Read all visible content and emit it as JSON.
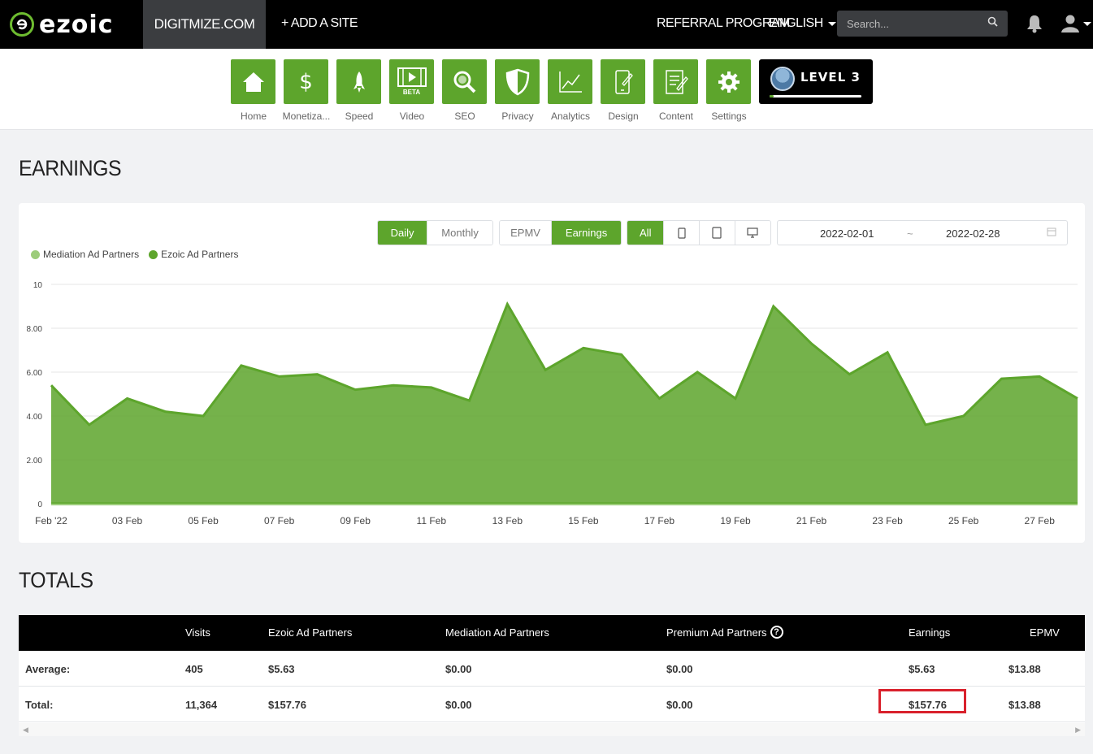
{
  "topbar": {
    "logo_text": "ezoic",
    "site_name": "DIGITMIZE.COM",
    "add_site": "+ ADD A SITE",
    "referral": "REFERRAL PROGRAM",
    "language": "ENGLISH",
    "search_placeholder": "Search..."
  },
  "nav": {
    "items": [
      {
        "label": "Home",
        "icon": "home-icon"
      },
      {
        "label": "Monetiza...",
        "icon": "dollar-icon"
      },
      {
        "label": "Speed",
        "icon": "rocket-icon"
      },
      {
        "label": "Video",
        "icon": "video-icon",
        "badge": "BETA"
      },
      {
        "label": "SEO",
        "icon": "magnifier-icon"
      },
      {
        "label": "Privacy",
        "icon": "shield-icon"
      },
      {
        "label": "Analytics",
        "icon": "line-chart-icon"
      },
      {
        "label": "Design",
        "icon": "mobile-design-icon"
      },
      {
        "label": "Content",
        "icon": "document-edit-icon"
      },
      {
        "label": "Settings",
        "icon": "gear-icon"
      }
    ],
    "level_label": "LEVEL 3",
    "level_progress": 0.04
  },
  "earnings": {
    "title": "EARNINGS",
    "period_buttons": [
      "Daily",
      "Monthly"
    ],
    "metric_buttons": [
      "EPMV",
      "Earnings"
    ],
    "device_all": "All",
    "date_from": "2022-02-01",
    "date_sep": "~",
    "date_to": "2022-02-28"
  },
  "chart_data": {
    "type": "area",
    "x": [
      "Feb '22",
      "02 Feb",
      "03 Feb",
      "04 Feb",
      "05 Feb",
      "06 Feb",
      "07 Feb",
      "08 Feb",
      "09 Feb",
      "10 Feb",
      "11 Feb",
      "12 Feb",
      "13 Feb",
      "14 Feb",
      "15 Feb",
      "16 Feb",
      "17 Feb",
      "18 Feb",
      "19 Feb",
      "20 Feb",
      "21 Feb",
      "22 Feb",
      "23 Feb",
      "24 Feb",
      "25 Feb",
      "26 Feb",
      "27 Feb",
      "28 Feb"
    ],
    "tick_labels": [
      "Feb '22",
      "03 Feb",
      "05 Feb",
      "07 Feb",
      "09 Feb",
      "11 Feb",
      "13 Feb",
      "15 Feb",
      "17 Feb",
      "19 Feb",
      "21 Feb",
      "23 Feb",
      "25 Feb",
      "27 Feb"
    ],
    "y_ticks": [
      "0",
      "2.00",
      "4.00",
      "6.00",
      "8.00",
      "10"
    ],
    "ylim": [
      0,
      10
    ],
    "series": [
      {
        "name": "Mediation Ad Partners",
        "color": "#9ccc7a",
        "values": [
          0,
          0,
          0,
          0,
          0,
          0,
          0,
          0,
          0,
          0,
          0,
          0,
          0,
          0,
          0,
          0,
          0,
          0,
          0,
          0,
          0,
          0,
          0,
          0,
          0,
          0,
          0,
          0
        ]
      },
      {
        "name": "Ezoic Ad Partners",
        "color": "#5da52c",
        "values": [
          5.4,
          3.6,
          4.8,
          4.2,
          4.0,
          6.3,
          5.8,
          5.9,
          5.2,
          5.4,
          5.3,
          4.7,
          9.1,
          6.1,
          7.1,
          6.8,
          4.8,
          6.0,
          4.8,
          9.0,
          7.3,
          5.9,
          6.9,
          3.6,
          4.0,
          5.7,
          5.8,
          4.8
        ]
      }
    ],
    "legend_position": "top-left",
    "grid": true
  },
  "totals": {
    "title": "TOTALS",
    "headers": [
      "",
      "Visits",
      "Ezoic Ad Partners",
      "Mediation Ad Partners",
      "Premium Ad Partners",
      "Earnings",
      "EPMV"
    ],
    "rows": [
      [
        "Average:",
        "405",
        "$5.63",
        "$0.00",
        "$0.00",
        "$5.63",
        "$13.88"
      ],
      [
        "Total:",
        "11,364",
        "$157.76",
        "$0.00",
        "$0.00",
        "$157.76",
        "$13.88"
      ]
    ]
  },
  "colors": {
    "accent": "#5da52c",
    "highlight": "#d9212c"
  }
}
